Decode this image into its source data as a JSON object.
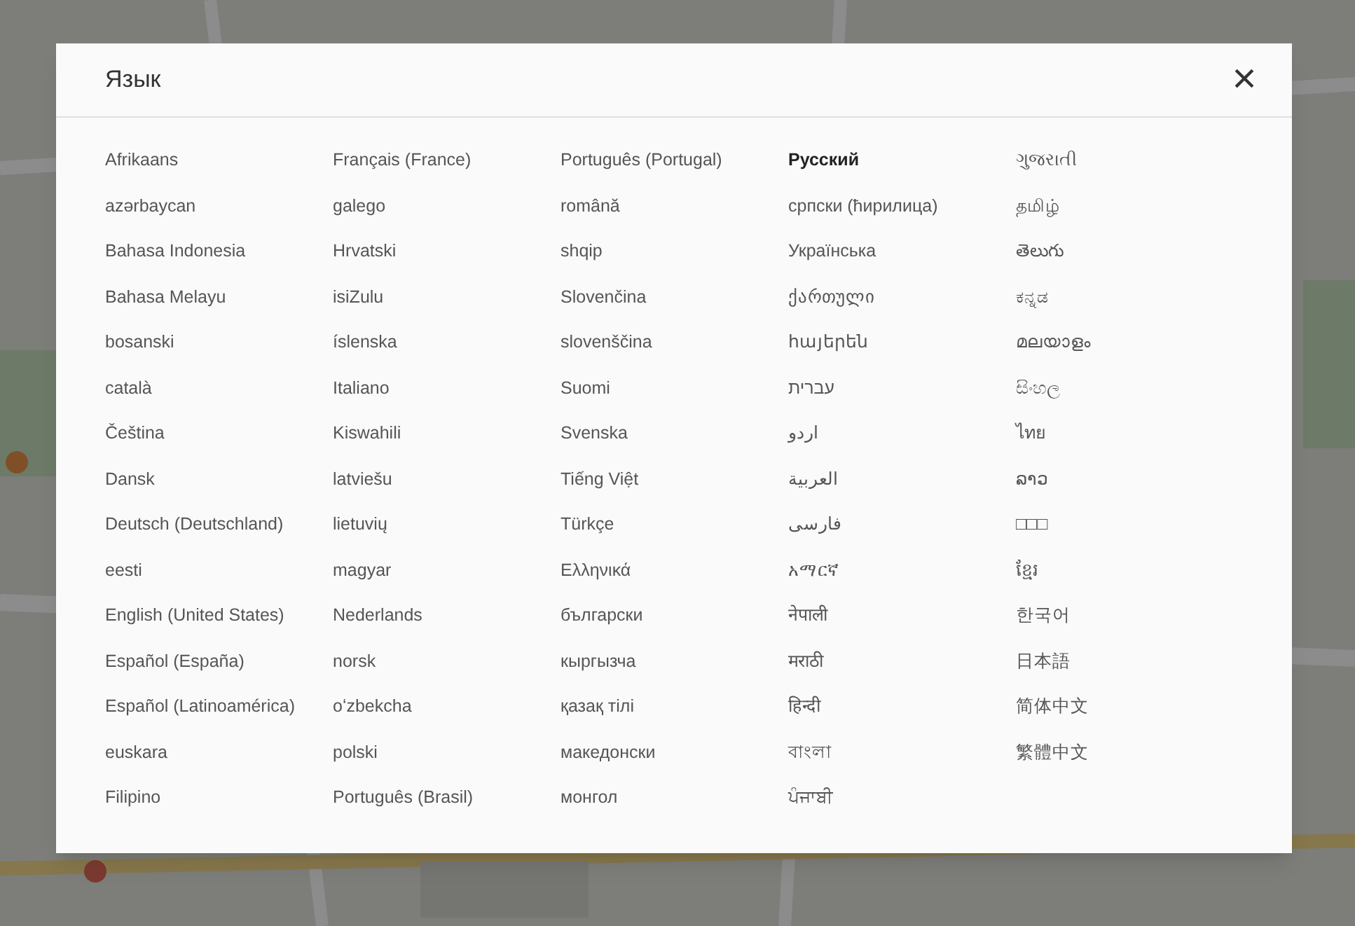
{
  "dialog": {
    "title": "Язык",
    "close": "×",
    "columns": [
      [
        {
          "label": "Afrikaans",
          "selected": false
        },
        {
          "label": "azərbaycan",
          "selected": false
        },
        {
          "label": "Bahasa Indonesia",
          "selected": false
        },
        {
          "label": "Bahasa Melayu",
          "selected": false
        },
        {
          "label": "bosanski",
          "selected": false
        },
        {
          "label": "català",
          "selected": false
        },
        {
          "label": "Čeština",
          "selected": false
        },
        {
          "label": "Dansk",
          "selected": false
        },
        {
          "label": "Deutsch (Deutschland)",
          "selected": false
        },
        {
          "label": "eesti",
          "selected": false
        },
        {
          "label": "English (United States)",
          "selected": false
        },
        {
          "label": "Español (España)",
          "selected": false
        },
        {
          "label": "Español (Latinoamérica)",
          "selected": false
        },
        {
          "label": "euskara",
          "selected": false
        },
        {
          "label": "Filipino",
          "selected": false
        }
      ],
      [
        {
          "label": "Français (France)",
          "selected": false
        },
        {
          "label": "galego",
          "selected": false
        },
        {
          "label": "Hrvatski",
          "selected": false
        },
        {
          "label": "isiZulu",
          "selected": false
        },
        {
          "label": "íslenska",
          "selected": false
        },
        {
          "label": "Italiano",
          "selected": false
        },
        {
          "label": "Kiswahili",
          "selected": false
        },
        {
          "label": "latviešu",
          "selected": false
        },
        {
          "label": "lietuvių",
          "selected": false
        },
        {
          "label": "magyar",
          "selected": false
        },
        {
          "label": "Nederlands",
          "selected": false
        },
        {
          "label": "norsk",
          "selected": false
        },
        {
          "label": "oʻzbekcha",
          "selected": false
        },
        {
          "label": "polski",
          "selected": false
        },
        {
          "label": "Português (Brasil)",
          "selected": false
        }
      ],
      [
        {
          "label": "Português (Portugal)",
          "selected": false
        },
        {
          "label": "română",
          "selected": false
        },
        {
          "label": "shqip",
          "selected": false
        },
        {
          "label": "Slovenčina",
          "selected": false
        },
        {
          "label": "slovenščina",
          "selected": false
        },
        {
          "label": "Suomi",
          "selected": false
        },
        {
          "label": "Svenska",
          "selected": false
        },
        {
          "label": "Tiếng Việt",
          "selected": false
        },
        {
          "label": "Türkçe",
          "selected": false
        },
        {
          "label": "Ελληνικά",
          "selected": false
        },
        {
          "label": "български",
          "selected": false
        },
        {
          "label": "кыргызча",
          "selected": false
        },
        {
          "label": "қазақ тілі",
          "selected": false
        },
        {
          "label": "македонски",
          "selected": false
        },
        {
          "label": "монгол",
          "selected": false
        }
      ],
      [
        {
          "label": "Русский",
          "selected": true
        },
        {
          "label": "српски (ћирилица)",
          "selected": false
        },
        {
          "label": "Українська",
          "selected": false
        },
        {
          "label": "ქართული",
          "selected": false
        },
        {
          "label": "հայերեն",
          "selected": false
        },
        {
          "label": "עברית",
          "selected": false
        },
        {
          "label": "اردو",
          "selected": false
        },
        {
          "label": "العربية",
          "selected": false
        },
        {
          "label": "فارسی",
          "selected": false
        },
        {
          "label": "አማርኛ",
          "selected": false
        },
        {
          "label": "नेपाली",
          "selected": false
        },
        {
          "label": "मराठी",
          "selected": false
        },
        {
          "label": "हिन्दी",
          "selected": false
        },
        {
          "label": "বাংলা",
          "selected": false
        },
        {
          "label": "ਪੰਜਾਬੀ",
          "selected": false
        }
      ],
      [
        {
          "label": "ગુજરાતી",
          "selected": false
        },
        {
          "label": "தமிழ்",
          "selected": false
        },
        {
          "label": "తెలుగు",
          "selected": false
        },
        {
          "label": "ಕನ್ನಡ",
          "selected": false
        },
        {
          "label": "മലയാളം",
          "selected": false
        },
        {
          "label": "සිංහල",
          "selected": false
        },
        {
          "label": "ไทย",
          "selected": false
        },
        {
          "label": "ລາວ",
          "selected": false
        },
        {
          "label": "□□□",
          "selected": false
        },
        {
          "label": "ខ្មែរ",
          "selected": false
        },
        {
          "label": "한국어",
          "selected": false
        },
        {
          "label": "日本語",
          "selected": false
        },
        {
          "label": "简体中文",
          "selected": false
        },
        {
          "label": "繁體中文",
          "selected": false
        }
      ]
    ]
  }
}
